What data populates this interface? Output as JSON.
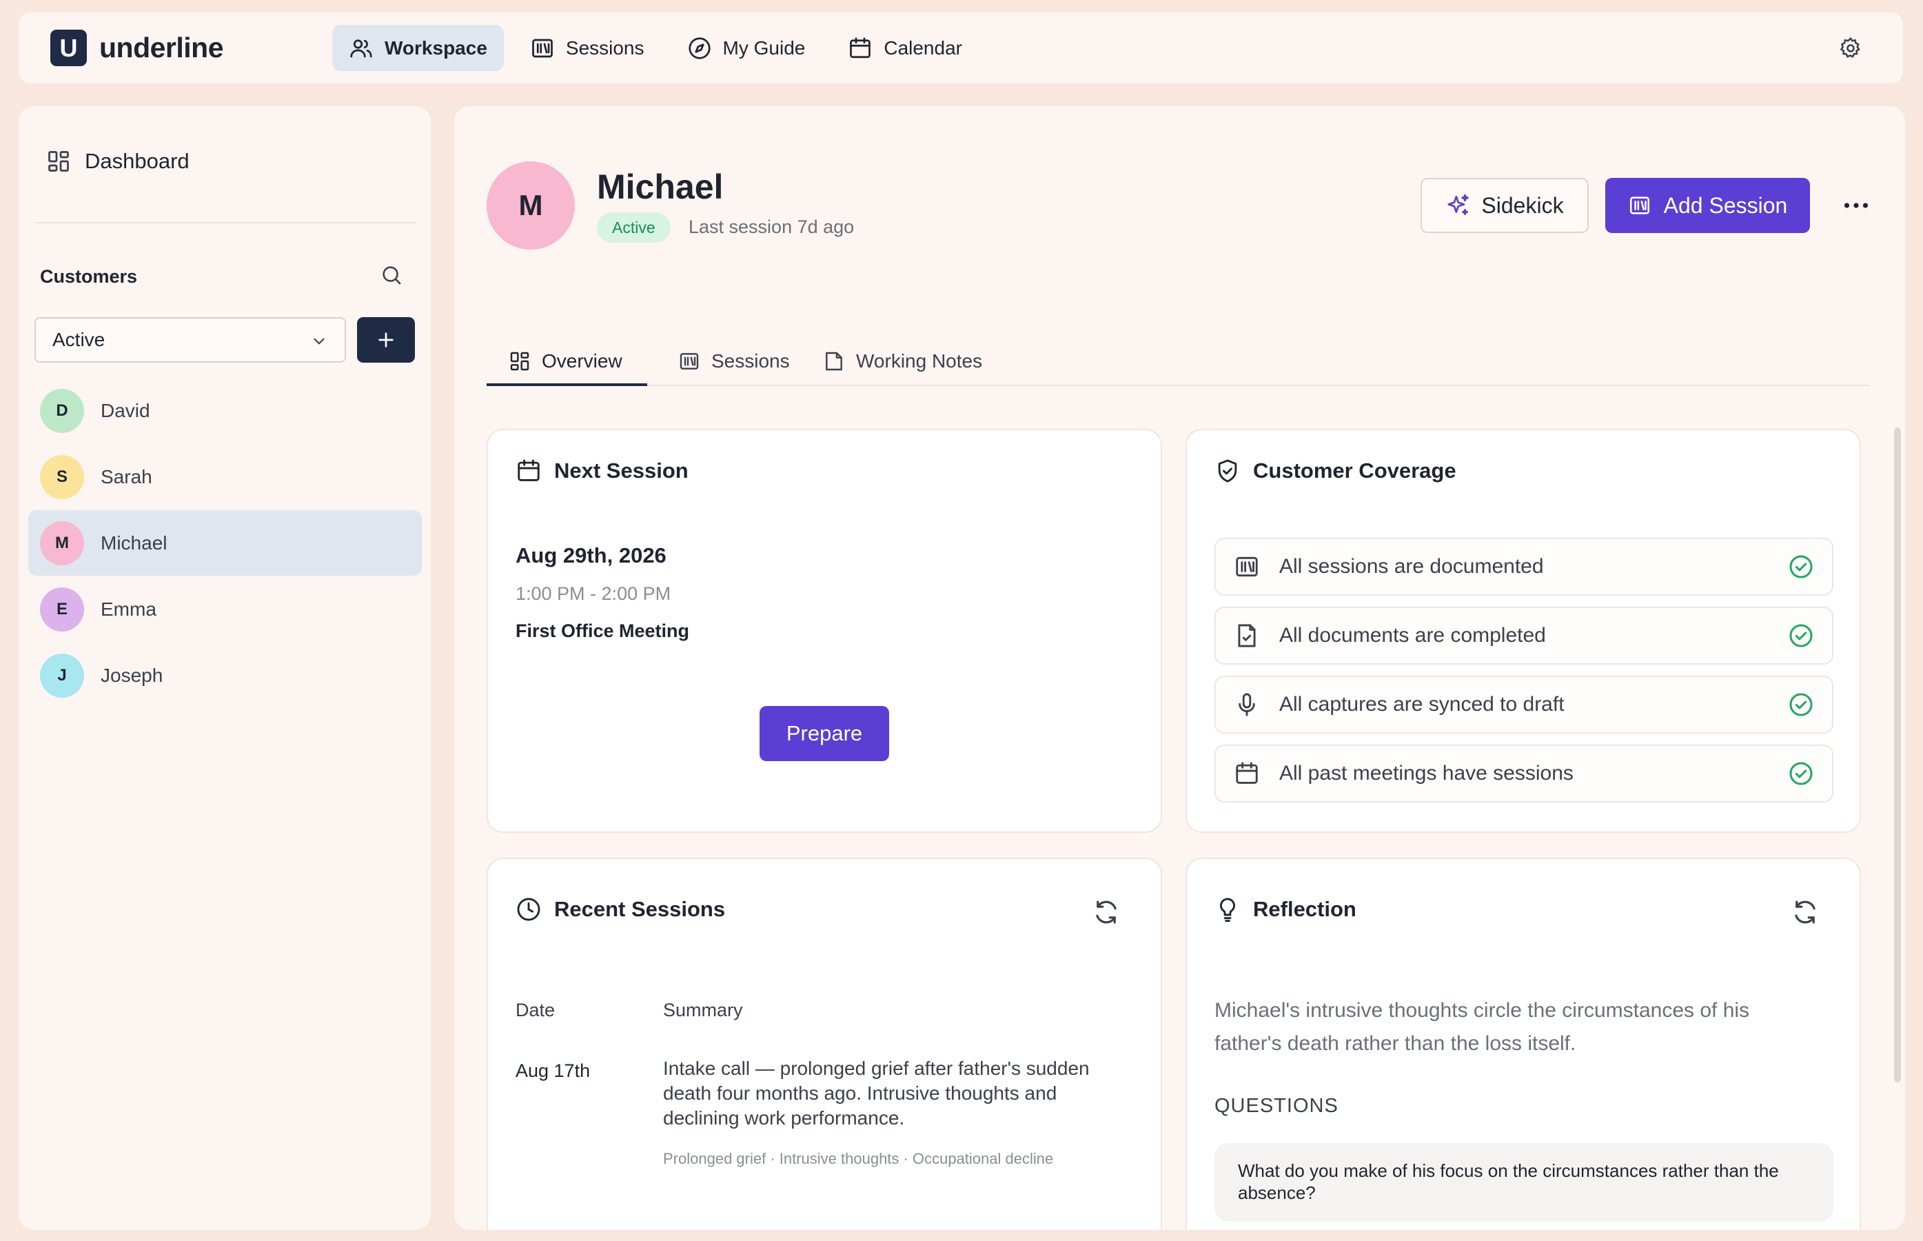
{
  "app": {
    "logo_letter": "U",
    "name": "underline"
  },
  "nav": [
    {
      "label": "Workspace",
      "icon": "users-icon"
    },
    {
      "label": "Sessions",
      "icon": "sessions-icon"
    },
    {
      "label": "My Guide",
      "icon": "compass-icon"
    },
    {
      "label": "Calendar",
      "icon": "calendar-icon"
    }
  ],
  "sidebar": {
    "dashboard_label": "Dashboard",
    "customers_title": "Customers",
    "filter_value": "Active",
    "customers": [
      {
        "initial": "D",
        "name": "David",
        "color": "#bde8c8"
      },
      {
        "initial": "S",
        "name": "Sarah",
        "color": "#fbe49a"
      },
      {
        "initial": "M",
        "name": "Michael",
        "color": "#f7b8d0"
      },
      {
        "initial": "E",
        "name": "Emma",
        "color": "#dcb2ec"
      },
      {
        "initial": "J",
        "name": "Joseph",
        "color": "#a8e6f0"
      }
    ]
  },
  "customer": {
    "initial": "M",
    "name": "Michael",
    "status": "Active",
    "last_session": "Last session 7d ago"
  },
  "actions": {
    "sidekick": "Sidekick",
    "add_session": "Add Session"
  },
  "tabs": [
    {
      "label": "Overview"
    },
    {
      "label": "Sessions"
    },
    {
      "label": "Working Notes"
    }
  ],
  "next_session": {
    "title": "Next Session",
    "date": "Aug 29th, 2026",
    "time": "1:00 PM - 2:00 PM",
    "name": "First Office Meeting",
    "prepare": "Prepare"
  },
  "coverage": {
    "title": "Customer Coverage",
    "items": [
      {
        "label": "All sessions are documented"
      },
      {
        "label": "All documents are completed"
      },
      {
        "label": "All captures are synced to draft"
      },
      {
        "label": "All past meetings have sessions"
      }
    ]
  },
  "recent_sessions": {
    "title": "Recent Sessions",
    "col_date": "Date",
    "col_summary": "Summary",
    "rows": [
      {
        "date": "Aug 17th",
        "summary": "Intake call — prolonged grief after father's sudden death four months ago. Intrusive thoughts and declining work performance.",
        "tags": "Prolonged grief · Intrusive thoughts · Occupational decline"
      }
    ]
  },
  "reflection": {
    "title": "Reflection",
    "text": "Michael's intrusive thoughts circle the circumstances of his father's death rather than the loss itself.",
    "questions_label": "QUESTIONS",
    "question": "What do you make of his focus on the circumstances rather than the absence?"
  },
  "colors": {
    "accent": "#5b3ed4",
    "navy": "#1f2b45",
    "success": "#22a861",
    "bg": "#f9e7de"
  }
}
